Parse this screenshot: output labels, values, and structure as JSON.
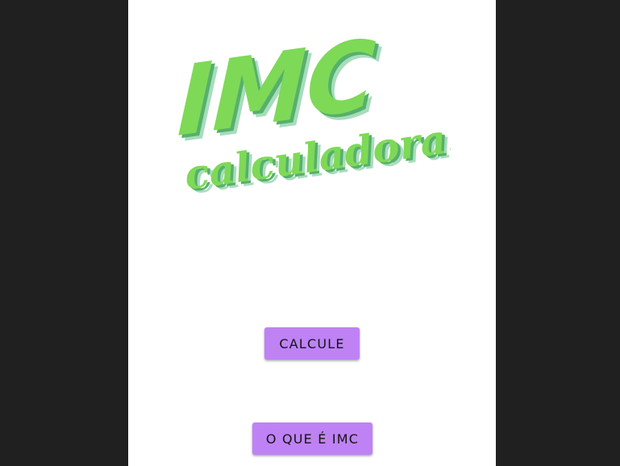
{
  "logo": {
    "line1": "IMC",
    "line2": "calculadora!",
    "colors": {
      "front": "#7ed957",
      "shadow_dark": "#56b06d",
      "shadow_light": "#a8dcbd"
    }
  },
  "buttons": {
    "calculate_label": "CALCULE",
    "what_is_imc_label": "O QUE É IMC"
  },
  "colors": {
    "backdrop": "#202020",
    "screen": "#ffffff",
    "button_bg": "#be82f5",
    "button_text": "#141414"
  }
}
